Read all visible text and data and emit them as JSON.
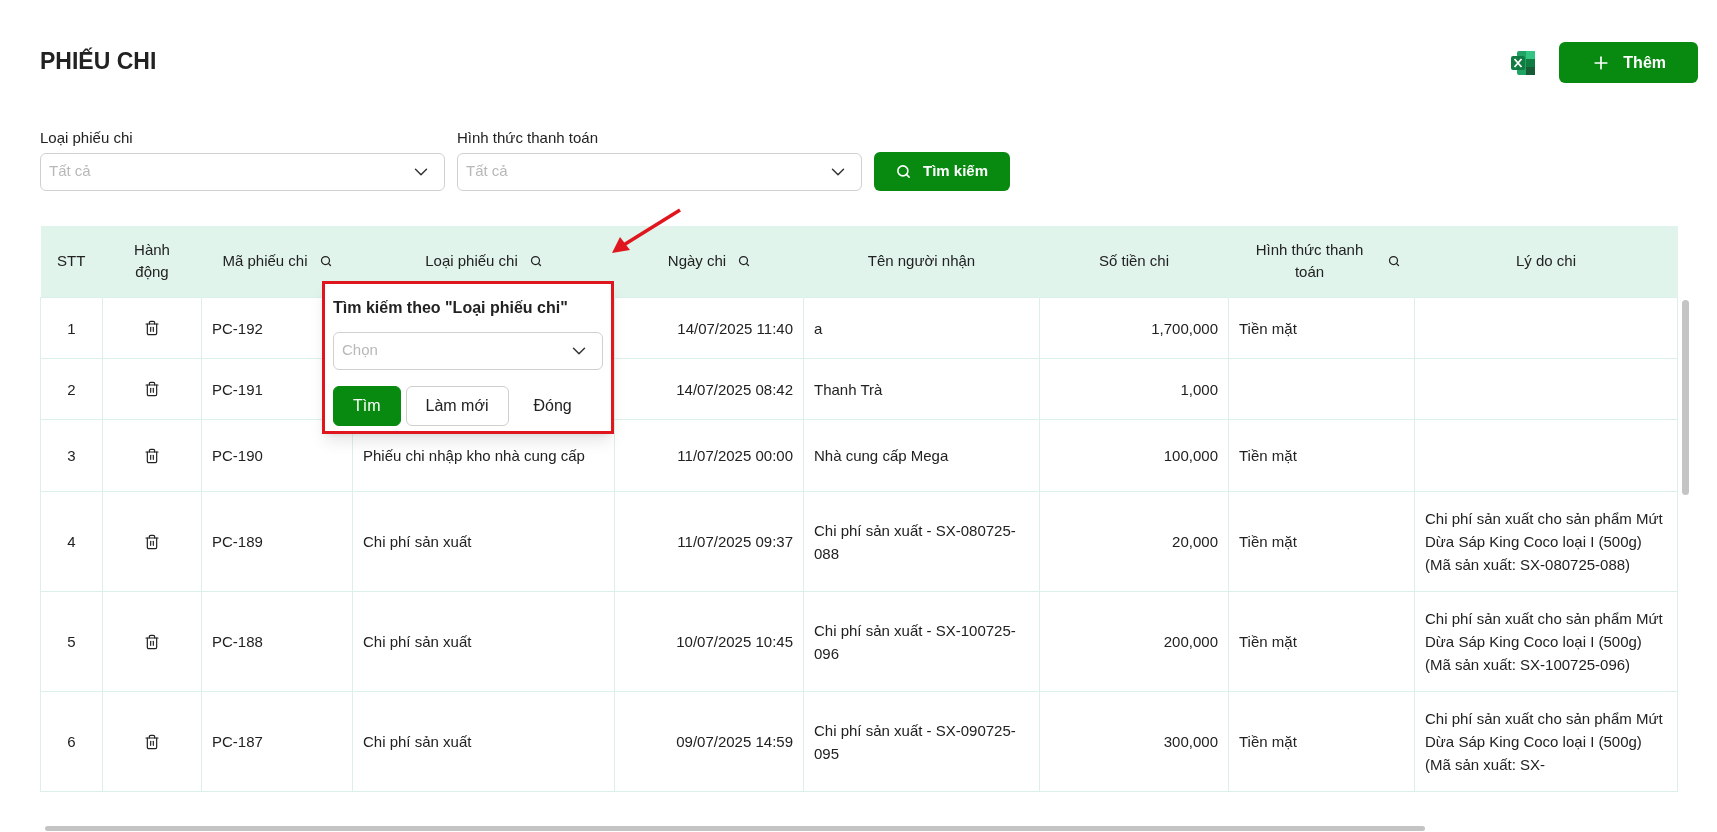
{
  "page": {
    "title": "PHIẾU CHI"
  },
  "toolbar": {
    "add_button": "Thêm"
  },
  "filters": [
    {
      "label": "Loại phiếu chi",
      "placeholder": "Tất cả"
    },
    {
      "label": "Hình thức thanh toán",
      "placeholder": "Tất cả"
    }
  ],
  "search_button": "Tìm kiếm",
  "table": {
    "columns": [
      {
        "label": "STT",
        "searchable": false
      },
      {
        "label": "Hành động",
        "searchable": false
      },
      {
        "label": "Mã phiếu chi",
        "searchable": true
      },
      {
        "label": "Loại phiếu chi",
        "searchable": true
      },
      {
        "label": "Ngày chi",
        "searchable": true
      },
      {
        "label": "Tên người nhận",
        "searchable": false
      },
      {
        "label": "Số tiền chi",
        "searchable": false
      },
      {
        "label": "Hình thức thanh toán",
        "searchable": true
      },
      {
        "label": "Lý do chi",
        "searchable": false
      }
    ],
    "rows": [
      {
        "stt": "1",
        "code": "PC-192",
        "date": "14/07/2025 11:40",
        "recipient": "a",
        "amount": "1,700,000",
        "payment": "Tiền mặt"
      },
      {
        "stt": "2",
        "code": "PC-191",
        "date": "14/07/2025 08:42",
        "recipient": "Thanh Trà",
        "amount": "1,000"
      },
      {
        "stt": "3",
        "code": "PC-190",
        "type": "Phiếu chi nhập kho nhà cung cấp",
        "date": "11/07/2025 00:00",
        "recipient": "Nhà cung cấp Mega",
        "amount": "100,000",
        "payment": "Tiền mặt"
      },
      {
        "stt": "4",
        "code": "PC-189",
        "type": "Chi phí sản xuất",
        "date": "11/07/2025 09:37",
        "recipient": "Chi phí sản xuất - SX-080725-088",
        "amount": "20,000",
        "payment": "Tiền mặt",
        "reason": "Chi phí sản xuất cho sản phẩm Mứt Dừa Sáp King Coco loại I (500g) (Mã sản xuất: SX-080725-088)"
      },
      {
        "stt": "5",
        "code": "PC-188",
        "type": "Chi phí sản xuất",
        "date": "10/07/2025 10:45",
        "recipient": "Chi phí sản xuất - SX-100725-096",
        "amount": "200,000",
        "payment": "Tiền mặt",
        "reason": "Chi phí sản xuất cho sản phẩm Mứt Dừa Sáp King Coco loại I (500g) (Mã sản xuất: SX-100725-096)"
      },
      {
        "stt": "6",
        "code": "PC-187",
        "type": "Chi phí sản xuất",
        "date": "09/07/2025 14:59",
        "recipient": "Chi phí sản xuất - SX-090725-095",
        "amount": "300,000",
        "payment": "Tiền mặt",
        "reason": "Chi phí sản xuất cho sản phẩm Mứt Dừa Sáp King Coco loại I (500g) (Mã sản xuất: SX-"
      }
    ]
  },
  "column_search_popup": {
    "title": "Tìm kiếm theo \"Loại phiếu chi\"",
    "placeholder": "Chọn",
    "buttons": [
      {
        "label": "Tìm",
        "kind": "primary"
      },
      {
        "label": "Làm mới",
        "kind": "outline"
      },
      {
        "label": "Đóng",
        "kind": "text"
      }
    ]
  }
}
